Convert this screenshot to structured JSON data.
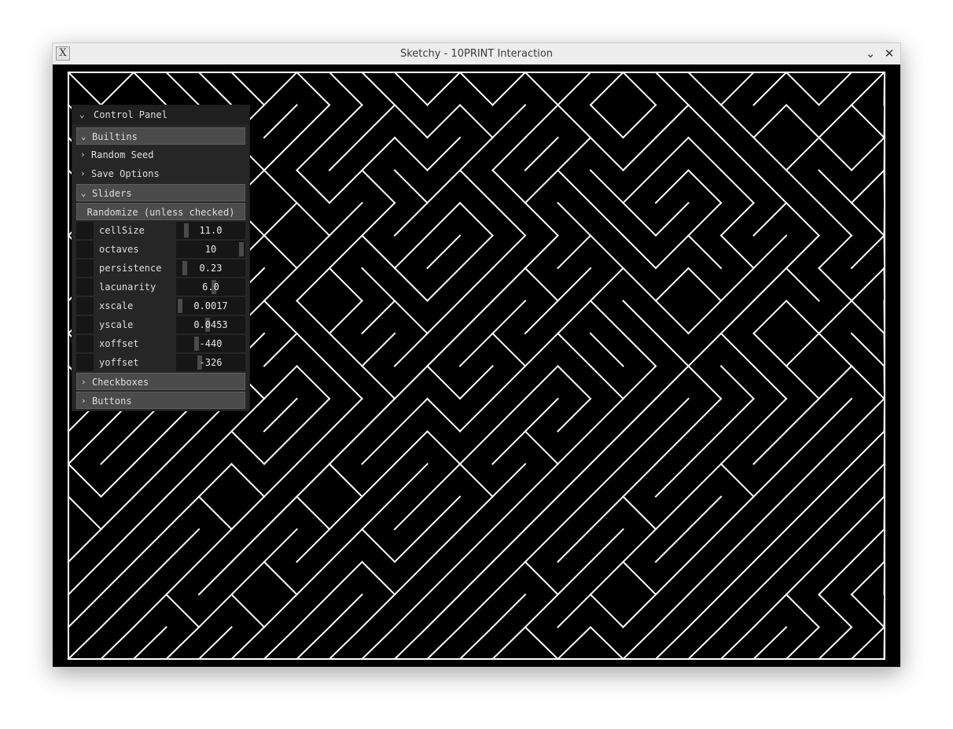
{
  "window": {
    "title": "Sketchy - 10PRINT Interaction",
    "icon_glyph": "X",
    "minimize_glyph": "⌄",
    "close_glyph": "✕"
  },
  "panel": {
    "title": "Control Panel",
    "folders": {
      "builtins": "Builtins",
      "random_seed": "Random Seed",
      "save_options": "Save Options",
      "sliders": "Sliders",
      "checkboxes": "Checkboxes",
      "buttons": "Buttons"
    },
    "randomize_label": "Randomize (unless checked)",
    "sliders": [
      {
        "name": "cellSize",
        "value": "11.0",
        "fraction": 0.12
      },
      {
        "name": "octaves",
        "value": "10",
        "fraction": 0.97
      },
      {
        "name": "persistence",
        "value": "0.23",
        "fraction": 0.1
      },
      {
        "name": "lacunarity",
        "value": "6.0",
        "fraction": 0.55
      },
      {
        "name": "xscale",
        "value": "0.0017",
        "fraction": 0.03
      },
      {
        "name": "yscale",
        "value": "0.0453",
        "fraction": 0.45
      },
      {
        "name": "xoffset",
        "value": "-440",
        "fraction": 0.28
      },
      {
        "name": "yoffset",
        "value": "-326",
        "fraction": 0.33
      }
    ]
  },
  "colors": {
    "canvas_bg": "#000000",
    "line": "#ffffff",
    "panel_bg": "#262626",
    "folder_bg": "#4b4b4b"
  }
}
